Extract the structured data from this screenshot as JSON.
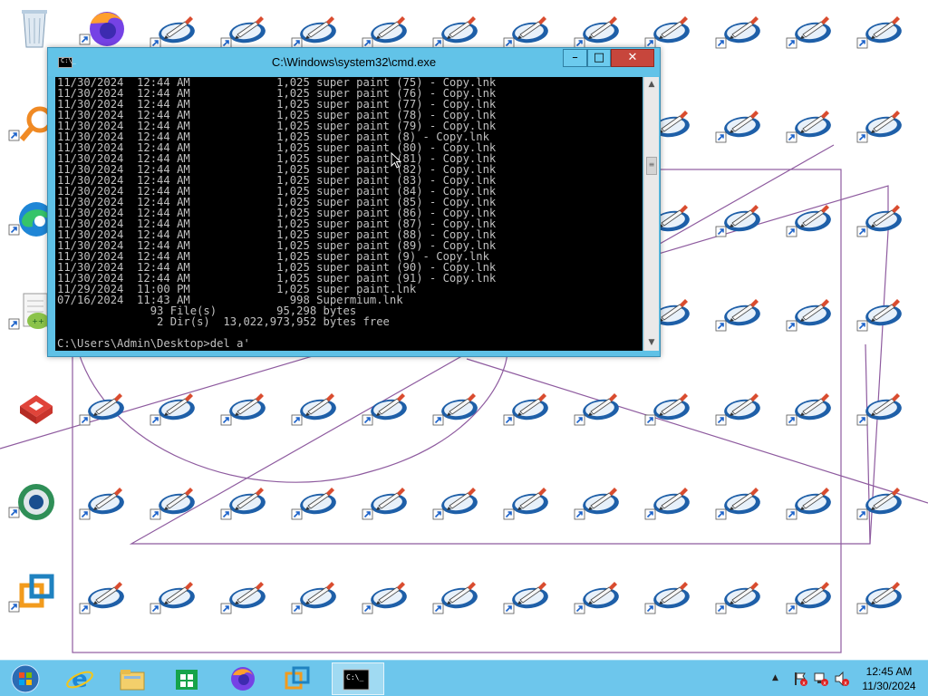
{
  "cmd": {
    "title": "C:\\Windows\\system32\\cmd.exe",
    "icon_label": "C:\\_",
    "lines": [
      "11/30/2024  12:44 AM             1,025 super paint (75) - Copy.lnk",
      "11/30/2024  12:44 AM             1,025 super paint (76) - Copy.lnk",
      "11/30/2024  12:44 AM             1,025 super paint (77) - Copy.lnk",
      "11/30/2024  12:44 AM             1,025 super paint (78) - Copy.lnk",
      "11/30/2024  12:44 AM             1,025 super paint (79) - Copy.lnk",
      "11/30/2024  12:44 AM             1,025 super paint (8) - Copy.lnk",
      "11/30/2024  12:44 AM             1,025 super paint (80) - Copy.lnk",
      "11/30/2024  12:44 AM             1,025 super paint (81) - Copy.lnk",
      "11/30/2024  12:44 AM             1,025 super paint (82) - Copy.lnk",
      "11/30/2024  12:44 AM             1,025 super paint (83) - Copy.lnk",
      "11/30/2024  12:44 AM             1,025 super paint (84) - Copy.lnk",
      "11/30/2024  12:44 AM             1,025 super paint (85) - Copy.lnk",
      "11/30/2024  12:44 AM             1,025 super paint (86) - Copy.lnk",
      "11/30/2024  12:44 AM             1,025 super paint (87) - Copy.lnk",
      "11/30/2024  12:44 AM             1,025 super paint (88) - Copy.lnk",
      "11/30/2024  12:44 AM             1,025 super paint (89) - Copy.lnk",
      "11/30/2024  12:44 AM             1,025 super paint (9) - Copy.lnk",
      "11/30/2024  12:44 AM             1,025 super paint (90) - Copy.lnk",
      "11/30/2024  12:44 AM             1,025 super paint (91) - Copy.lnk",
      "11/29/2024  11:00 PM             1,025 super paint.lnk",
      "07/16/2024  11:43 AM               998 Supermium.lnk",
      "              93 File(s)         95,298 bytes",
      "               2 Dir(s)  13,022,973,952 bytes free",
      "",
      "C:\\Users\\Admin\\Desktop>del a'"
    ]
  },
  "desktop_icons": {
    "left_column": [
      "recycle-bin-icon",
      "search-magnifier-shortcut-icon",
      "edge-shortcut-icon",
      "notepad-plus-plus-shortcut-icon",
      "red-box-app-shortcut-icon",
      "chrome-like-shortcut-icon",
      "vmware-shortcut-icon"
    ],
    "firefox_top": "firefox-shortcut-icon",
    "repeated": "super-paint-shortcut-icon"
  },
  "taskbar": {
    "pinned": [
      "start-orb-icon",
      "ie-icon",
      "file-explorer-icon",
      "store-icon",
      "firefox-icon",
      "vmware-icon",
      "cmd-icon"
    ],
    "clock_time": "12:45 AM",
    "clock_date": "11/30/2024"
  },
  "colors": {
    "taskbar": "#6dc6ec",
    "titlebar": "#62c3e8",
    "close": "#c7463c",
    "scribble": "#7b3f8f"
  }
}
